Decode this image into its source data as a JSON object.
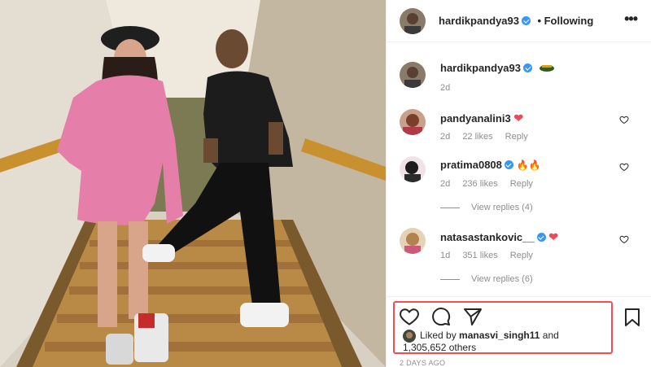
{
  "post": {
    "author": "hardikpandya93",
    "follow_state": "• Following",
    "more_label": "•••"
  },
  "caption": {
    "username": "hardikpandya93",
    "time": "2d"
  },
  "comments": [
    {
      "username": "pandyanalini3",
      "verified": false,
      "emoji": "❤",
      "time": "2d",
      "likes": "22 likes",
      "reply": "Reply"
    },
    {
      "username": "pratima0808",
      "verified": true,
      "emoji": "🔥🔥",
      "time": "2d",
      "likes": "236 likes",
      "reply": "Reply",
      "view_replies": "View replies (4)"
    },
    {
      "username": "natasastankovic__",
      "verified": true,
      "emoji": "❤",
      "time": "1d",
      "likes": "351 likes",
      "reply": "Reply",
      "view_replies": "View replies (6)"
    }
  ],
  "likes": {
    "prefix": "Liked by",
    "user": "manasvi_singh11",
    "conj": "and",
    "others": "1,305,652 others"
  },
  "posted_ago": "2 DAYS AGO",
  "colors": {
    "verified": "#3897f0",
    "heart_red": "#ed4956",
    "highlight_box": "#ef4e57",
    "muted_text": "#8e8e8e"
  },
  "icons": [
    "like-icon",
    "comment-icon",
    "share-icon",
    "save-icon",
    "more-icon",
    "verified-icon",
    "heart-icon"
  ]
}
